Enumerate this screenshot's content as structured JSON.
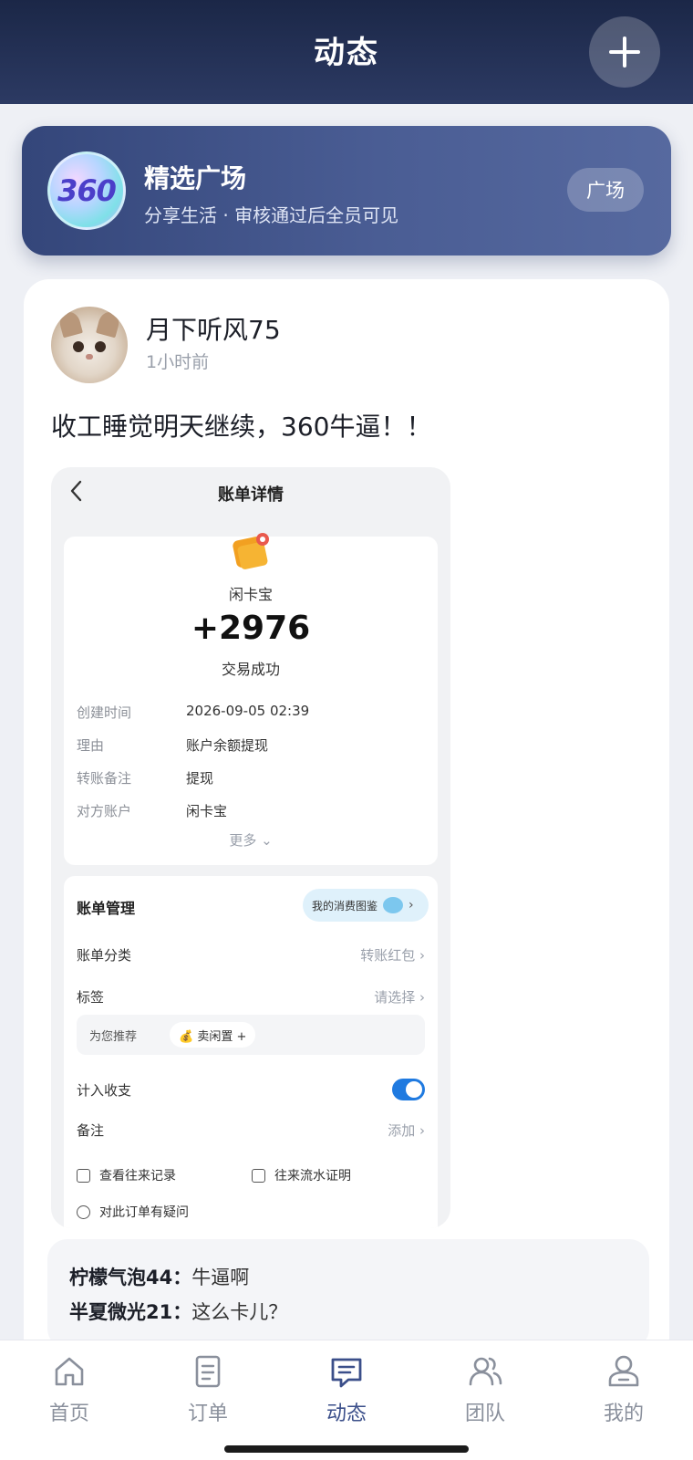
{
  "header": {
    "title": "动态",
    "add_icon": "plus-icon"
  },
  "plaza": {
    "logo_text": "360",
    "title": "精选广场",
    "subtitle": "分享生活 · 审核通过后全员可见",
    "button_label": "广场"
  },
  "post": {
    "username": "月下听风75",
    "time": "1小时前",
    "text": "收工睡觉明天继续，360牛逼！！",
    "image": {
      "title": "账单详情",
      "merchant": "闲卡宝",
      "amount": "+2976",
      "status": "交易成功",
      "details": [
        {
          "key": "创建时间",
          "value": "2026-09-05    02:39"
        },
        {
          "key": "理由",
          "value": "账户余额提现"
        },
        {
          "key": "转账备注",
          "value": "提现"
        },
        {
          "key": "对方账户",
          "value": "闲卡宝"
        }
      ],
      "more_label": "更多 ⌄",
      "management": {
        "title": "账单管理",
        "chip_label": "我的消费图鉴",
        "category_label": "账单分类",
        "category_value": "转账红包  ›",
        "tag_label": "标签",
        "tag_value": "请选择  ›",
        "recommend_label": "为您推荐",
        "recommend_tag": "💰 卖闲置  +",
        "income_label": "计入收支",
        "note_label": "备注",
        "note_value": "添加  ›",
        "history_link": "查看往来记录",
        "proof_link": "往来流水证明",
        "question_link": "对此订单有疑问"
      }
    }
  },
  "comments": [
    {
      "author": "柠檬气泡44：",
      "text": "牛逼啊"
    },
    {
      "author": "半夏微光21：",
      "text": "这么卡儿？"
    }
  ],
  "tabbar": {
    "items": [
      {
        "label": "首页",
        "icon": "home-icon"
      },
      {
        "label": "订单",
        "icon": "document-icon"
      },
      {
        "label": "动态",
        "icon": "message-icon",
        "active": true
      },
      {
        "label": "团队",
        "icon": "team-icon"
      },
      {
        "label": "我的",
        "icon": "user-icon"
      }
    ]
  },
  "colors": {
    "header": "#1b2747",
    "active_tab": "#3b4f8a",
    "toggle": "#1f7ae0"
  }
}
